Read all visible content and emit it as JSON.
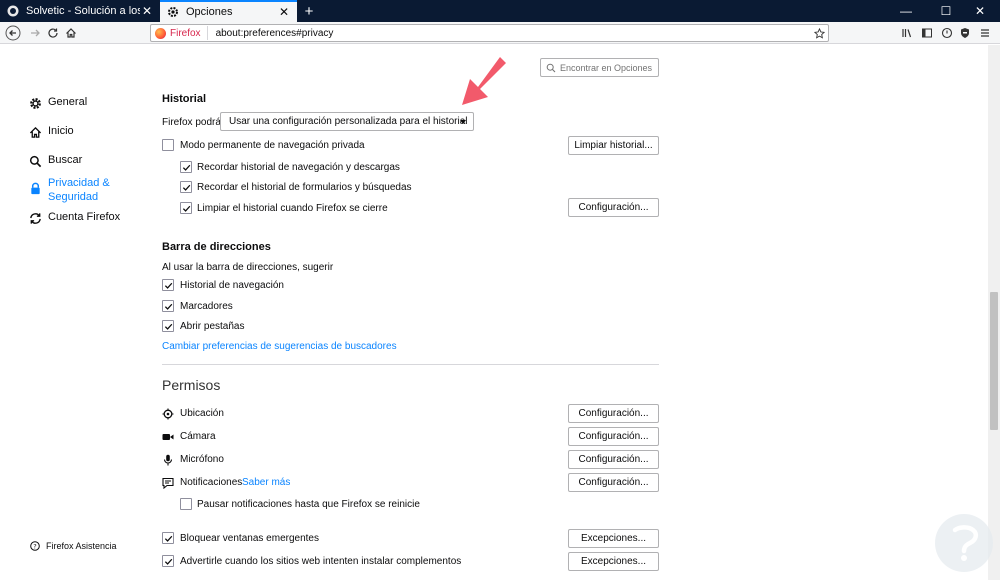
{
  "tabs": [
    {
      "title": "Solvetic - Solución a los probl",
      "active": false
    },
    {
      "title": "Opciones",
      "active": true
    }
  ],
  "window": {
    "minimize": "—",
    "maximize": "☐",
    "close": "✕"
  },
  "navbar": {
    "identity_label": "Firefox",
    "url": "about:preferences#privacy"
  },
  "sidebar": {
    "items": [
      {
        "label": "General",
        "icon": "gear-icon"
      },
      {
        "label": "Inicio",
        "icon": "home-icon"
      },
      {
        "label": "Buscar",
        "icon": "search-icon"
      },
      {
        "label_line1": "Privacidad &",
        "label_line2": "Seguridad",
        "icon": "lock-icon",
        "selected": true
      },
      {
        "label": "Cuenta Firefox",
        "icon": "sync-icon"
      }
    ],
    "assist": "Firefox Asistencia"
  },
  "search": {
    "placeholder": "Encontrar en Opciones"
  },
  "history": {
    "title": "Historial",
    "mode_label": "Firefox podrá",
    "mode_value": "Usar una configuración personalizada para el historial",
    "private_mode": "Modo permanente de navegación privada",
    "clear_button": "Limpiar historial...",
    "remember_browsing": "Recordar historial de navegación y descargas",
    "remember_forms": "Recordar el historial de formularios y búsquedas",
    "clear_on_close": "Limpiar el historial cuando Firefox se cierre",
    "config_button": "Configuración..."
  },
  "address_bar": {
    "title": "Barra de direcciones",
    "intro": "Al usar la barra de direcciones, sugerir",
    "history": "Historial de navegación",
    "bookmarks": "Marcadores",
    "tabs": "Abrir pestañas",
    "link": "Cambiar preferencias de sugerencias de buscadores"
  },
  "permissions": {
    "title": "Permisos",
    "location": "Ubicación",
    "camera": "Cámara",
    "microphone": "Micrófono",
    "notifications": "Notificaciones",
    "learn_more": "Saber más",
    "pause_notifications": "Pausar notificaciones hasta que Firefox se reinicie",
    "config_button": "Configuración...",
    "block_popups": "Bloquear ventanas emergentes",
    "warn_addons": "Advertirle cuando los sitios web intenten instalar complementos",
    "exceptions_button": "Excepciones..."
  },
  "colors": {
    "accent": "#0a84ff",
    "titlebar": "#0a1a33",
    "arrow": "#f25a6b"
  }
}
